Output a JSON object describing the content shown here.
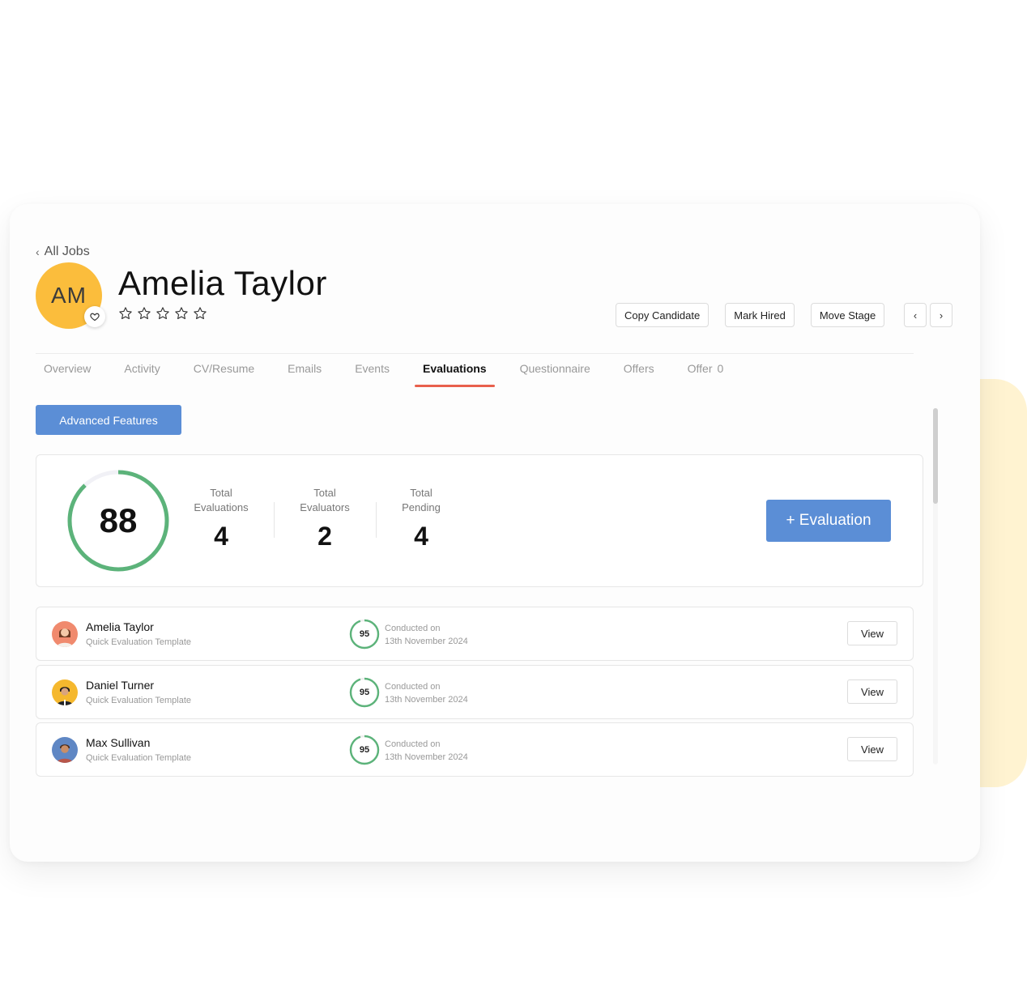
{
  "nav": {
    "back_label": "All Jobs"
  },
  "candidate": {
    "initials": "AM",
    "name": "Amelia Taylor",
    "rating_stars": 5,
    "rating_filled": 0
  },
  "actions": {
    "copy": "Copy Candidate",
    "hired": "Mark Hired",
    "move": "Move Stage",
    "prev": "‹",
    "next": "›"
  },
  "tabs": [
    {
      "label": "Overview"
    },
    {
      "label": "Activity"
    },
    {
      "label": "CV/Resume"
    },
    {
      "label": "Emails"
    },
    {
      "label": "Events"
    },
    {
      "label": "Evaluations",
      "active": true
    },
    {
      "label": "Questionnaire"
    },
    {
      "label": "Offers"
    },
    {
      "label": "Offer",
      "count": "0"
    }
  ],
  "advanced_button": "Advanced Features",
  "summary": {
    "score": "88",
    "score_fraction": 0.88,
    "stats": [
      {
        "label_top": "Total",
        "label_bottom": "Evaluations",
        "value": "4"
      },
      {
        "label_top": "Total",
        "label_bottom": "Evaluators",
        "value": "2"
      },
      {
        "label_top": "Total",
        "label_bottom": "Pending",
        "value": "4"
      }
    ],
    "evaluation_button": "+ Evaluation"
  },
  "evaluations": [
    {
      "name": "Amelia Taylor",
      "template": "Quick Evaluation Template",
      "score": "95",
      "conducted_label": "Conducted on",
      "date": "13th November 2024",
      "view": "View"
    },
    {
      "name": "Daniel Turner",
      "template": "Quick Evaluation Template",
      "score": "95",
      "conducted_label": "Conducted on",
      "date": "13th November 2024",
      "view": "View"
    },
    {
      "name": "Max Sullivan",
      "template": "Quick Evaluation Template",
      "score": "95",
      "conducted_label": "Conducted on",
      "date": "13th November 2024",
      "view": "View"
    }
  ],
  "colors": {
    "accent_blue": "#5b8ed6",
    "score_green": "#5cb37a",
    "tab_underline": "#e8604c",
    "avatar_yellow": "#fbbd3c",
    "bg_yellow": "#fff3d1"
  }
}
